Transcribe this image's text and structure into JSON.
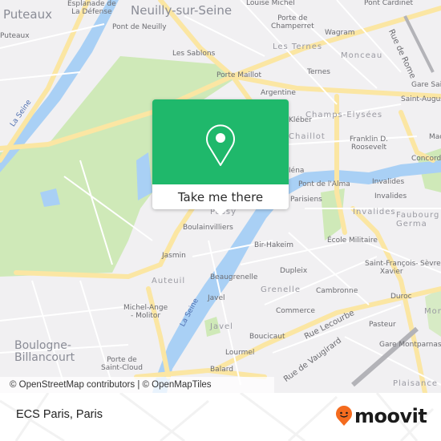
{
  "map": {
    "labels": {
      "puteaux_big": "Puteaux",
      "puteaux_small": "Puteaux",
      "esplanade": "Esplanade de\nLa Défense",
      "neuilly": "Neuilly-sur-Seine",
      "pont_neuilly": "Pont de Neuilly",
      "les_sablons": "Les Sablons",
      "louise_michel": "Louise Michel",
      "porte_champerret": "Porte de\nChamperret",
      "wagram": "Wagram",
      "pont_cardinet": "Pont Cardinet",
      "rue_de_rome": "Rue de Rome",
      "les_ternes": "Les Ternes",
      "monceau": "Monceau",
      "porte_maillot": "Porte Maillot",
      "ternes": "Ternes",
      "argentine": "Argentine",
      "gare_saint": "Gare Saint-Lazare",
      "saint_augustin": "Saint-Augustin",
      "champs_elysees": "Champs-Elysées",
      "kleber": "Kléber",
      "chaillot": "Chaillot",
      "franklin": "Franklin D.\nRoosevelt",
      "iena": "Iéna",
      "madeleine": "Madeleine",
      "concorde": "Concorde",
      "pont_alma": "Pont de l'Alma",
      "invalides1": "Invalides",
      "invalides2": "Invalides",
      "parisiens": "Parisiens",
      "invalides_district": "Invalides",
      "faubourg": "Faubourg\nGerma",
      "passy": "Passy",
      "boulainvilliers": "Boulainvilliers",
      "bir_hakeim": "Bir-Hakeim",
      "ecole_militaire": "École Militaire",
      "jasmin": "Jasmin",
      "dupleix": "Dupleix",
      "saint_francois": "Saint-François-\nXavier",
      "sevres": "Sèvres",
      "auteuil": "Auteuil",
      "beaugrenelle": "Beaugrenelle",
      "grenelle": "Grenelle",
      "cambronne": "Cambronne",
      "duroc": "Duroc",
      "michel_ange": "Michel-Ange\n- Molitor",
      "javel_st": "Javel",
      "commerce": "Commerce",
      "montparnasse": "Montparnasse",
      "la_seine_1": "La Seine",
      "la_seine_2": "La Seine",
      "rue_lecourbe": "Rue Lecourbe",
      "pasteur": "Pasteur",
      "javel_district": "Javel",
      "boucicaut": "Boucicaut",
      "gare_montparnasse": "Gare Montparnasse",
      "rue_vaugirard": "Rue de Vaugirard",
      "boulogne": "Boulogne-\nBillancourt",
      "lourmel": "Lourmel",
      "porte_saint_cloud": "Porte de\nSaint-Cloud",
      "balard": "Balard",
      "plaisance": "Plaisance"
    },
    "attribution": "© OpenStreetMap contributors | © OpenMapTiles"
  },
  "popup": {
    "icon": "map-pin-icon",
    "button_label": "Take me there",
    "color": "#1fb86b"
  },
  "footer": {
    "place_name": "ECS Paris, Paris",
    "brand": {
      "name": "moovit",
      "icon": "moovit-smiley-pin-icon",
      "color": "#f46b1e"
    }
  }
}
